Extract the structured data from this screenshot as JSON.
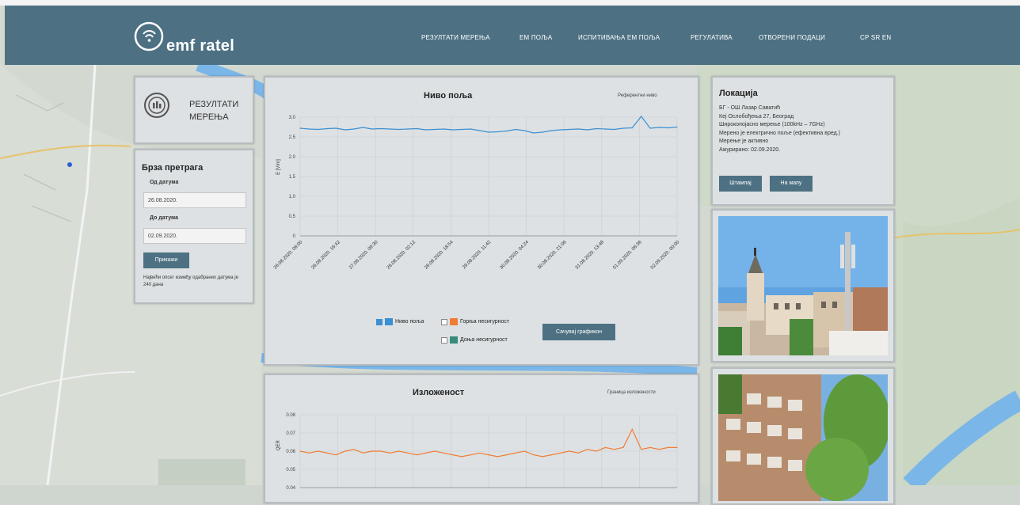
{
  "header": {
    "logo_text": "emf ratel",
    "nav": [
      "РЕЗУЛТАТИ МЕРЕЊА",
      "ЕМ ПОЉА",
      "ИСПИТИВАЊА ЕМ ПОЉА",
      "РЕГУЛАТИВА",
      "ОТВОРЕНИ ПОДАЦИ",
      "СР  SR  EN"
    ]
  },
  "results_box": {
    "title_line1": "РЕЗУЛТАТИ",
    "title_line2": "МЕРЕЊА"
  },
  "search": {
    "title": "Брза претрага",
    "from_label": "Од датума",
    "from_value": "26.08.2020.",
    "to_label": "До датума",
    "to_value": "02.09.2020.",
    "show_button": "Прикажи",
    "note": "Највећи опсег између одабраних датума је 240 дана"
  },
  "location": {
    "title": "Локација",
    "lines": [
      "БГ - ОШ Лазар Саватић",
      "Кеј Ослобођења 27, Београд",
      "Широкопојасно мерење (100kHz – 7GHz)",
      "Мерено је електрично поље (ефективна вред.)",
      "Мерење је активно",
      "Ажурирано: 02.09.2020."
    ],
    "print_button": "Штампај",
    "map_button": "На мапу"
  },
  "chart1": {
    "title": "Ниво поља",
    "ref_label": "Референтни ниво",
    "legend": [
      "Ниво поља",
      "Горња несигурност",
      "Доња несигурност"
    ],
    "save_button": "Сачувај графикон"
  },
  "chart2": {
    "title": "Изложеност",
    "ref_label": "Граница изложености"
  },
  "chart_data": [
    {
      "type": "line",
      "title": "Ниво поља",
      "ylabel": "E [V/m]",
      "ylim": [
        0,
        3.0
      ],
      "yticks": [
        "3.0",
        "2.5",
        "2.0",
        "1.5",
        "1.0",
        "0.5",
        "0"
      ],
      "categories": [
        "26.08.2020. 06:00",
        "26.08.2020. 16:42",
        "27.08.2020. 09:30",
        "28.08.2020. 02:12",
        "28.08.2020. 18:54",
        "29.08.2020. 11:42",
        "30.08.2020. 04:24",
        "30.08.2020. 21:06",
        "31.08.2020. 13:48",
        "01.09.2020. 06:36",
        "02.09.2020. 00:00"
      ],
      "series": [
        {
          "name": "Ниво поља",
          "color": "#3d8fd1",
          "values": [
            2.72,
            2.7,
            2.69,
            2.71,
            2.72,
            2.68,
            2.7,
            2.74,
            2.7,
            2.71,
            2.7,
            2.69,
            2.7,
            2.71,
            2.68,
            2.69,
            2.7,
            2.68,
            2.69,
            2.7,
            2.66,
            2.62,
            2.63,
            2.65,
            2.69,
            2.66,
            2.6,
            2.62,
            2.66,
            2.68,
            2.69,
            2.7,
            2.68,
            2.71,
            2.7,
            2.69,
            2.72,
            2.73,
            3.02,
            2.72,
            2.74,
            2.73,
            2.75
          ]
        }
      ],
      "grid": true,
      "legend": "bottom"
    },
    {
      "type": "line",
      "title": "Изложеност",
      "ylabel": "QER",
      "ylim": [
        0.04,
        0.08
      ],
      "yticks": [
        "0.08",
        "0.07",
        "0.06",
        "0.05",
        "0.04"
      ],
      "series": [
        {
          "name": "Ниво поља",
          "color": "#f07d35",
          "values": [
            0.06,
            0.059,
            0.06,
            0.059,
            0.058,
            0.06,
            0.061,
            0.059,
            0.06,
            0.06,
            0.059,
            0.06,
            0.059,
            0.058,
            0.059,
            0.06,
            0.059,
            0.058,
            0.057,
            0.058,
            0.059,
            0.058,
            0.057,
            0.058,
            0.059,
            0.06,
            0.058,
            0.057,
            0.058,
            0.059,
            0.06,
            0.059,
            0.061,
            0.06,
            0.062,
            0.061,
            0.062,
            0.072,
            0.061,
            0.062,
            0.061,
            0.062,
            0.062
          ]
        }
      ],
      "grid": true
    }
  ],
  "colors": {
    "header": "#4d7183",
    "nivo": "#3d8fd1",
    "upper": "#f07d35",
    "lower": "#3a8c7a"
  }
}
